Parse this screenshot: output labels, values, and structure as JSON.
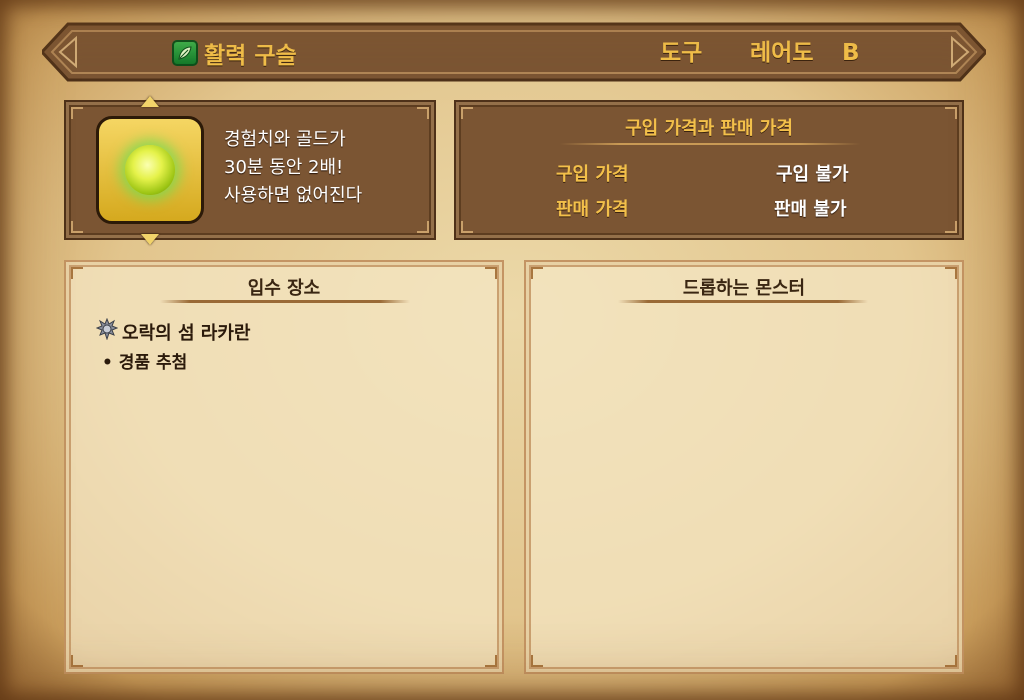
{
  "header": {
    "item_name": "활력 구슬",
    "category": "도구",
    "rarity_label": "레어도",
    "rarity_value": "B",
    "icon": "leaf-icon"
  },
  "item": {
    "icon": "glowing-green-orb",
    "description": [
      "경험치와 골드가",
      "30분 동안 2배!",
      "사용하면 없어진다"
    ]
  },
  "price": {
    "title": "구입 가격과 판매 가격",
    "buy_label": "구입 가격",
    "buy_value": "구입 불가",
    "sell_label": "판매 가격",
    "sell_value": "판매 불가"
  },
  "obtain": {
    "title": "입수 장소",
    "location": "오락의 섬 라카란",
    "location_icon": "spiky-shell-icon",
    "method_bullet": "•",
    "method": "경품 추첨"
  },
  "drops": {
    "title": "드롭하는 몬스터"
  },
  "colors": {
    "gold_text": "#f3c04a",
    "panel_dark": "#7b5533",
    "parchment": "#e2c58d"
  }
}
